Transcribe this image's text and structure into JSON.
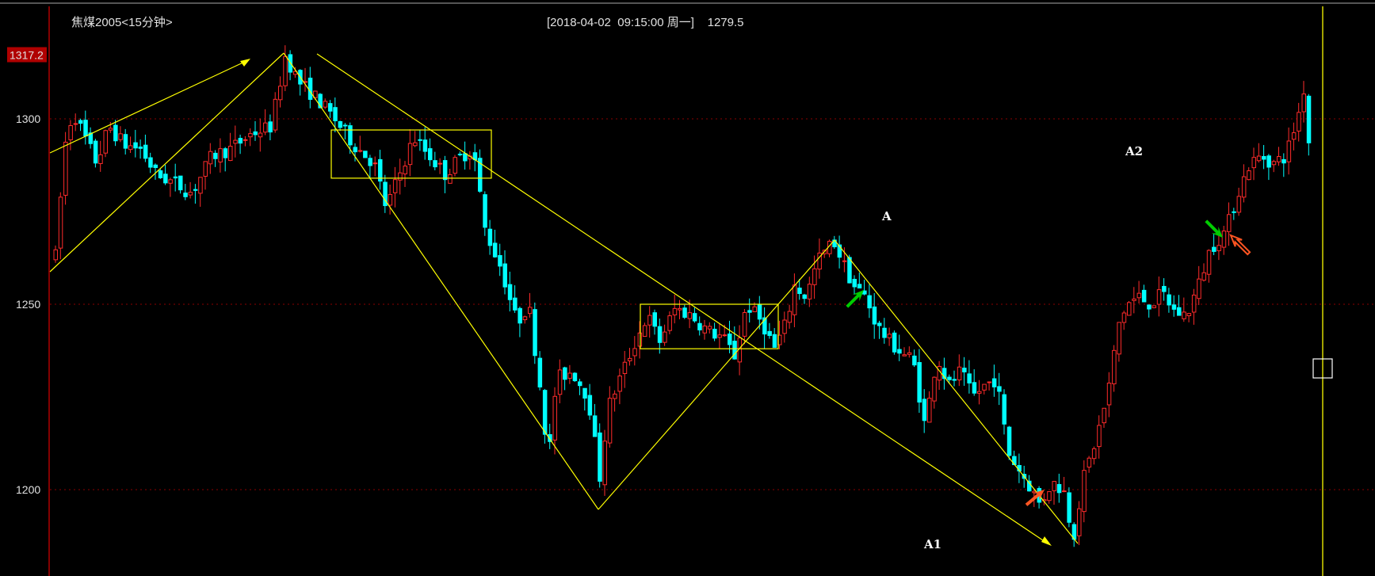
{
  "window": {
    "symbol_title": "焦煤2005<15分钟>",
    "cursor_info": "[2018-04-02  09:15:00 周一]    1279.5"
  },
  "colors": {
    "background": "#000000",
    "up": "#ff2b2b",
    "down": "#00ffff",
    "trendline": "#ffff00",
    "gridline": "#8b0000",
    "axis": "#b00000",
    "price_tag": "#b00000",
    "arrow_green": "#00cc00",
    "arrow_orange": "#ff5522",
    "annotation_text": "#ffffff"
  },
  "chart_data": {
    "type": "candlestick",
    "title": "焦煤2005<15分钟>",
    "y_ticks": [
      1300,
      1250,
      1200
    ],
    "y_range": [
      1177,
      1320
    ],
    "y_high_label": "1317.2",
    "grid": "horizontal dotted",
    "annotations": [
      "A",
      "A2",
      "A1"
    ],
    "lows": {
      "first_low": 1195,
      "A1_low": 1186
    },
    "highs": {
      "start_high": 1317.2,
      "mid_high": 1267,
      "end_high": 1310
    },
    "consolidation_zones": [
      {
        "from_price": 1297,
        "to_price": 1284
      },
      {
        "from_price": 1250,
        "to_price": 1238
      }
    ],
    "cursor_price": 1279.5
  }
}
